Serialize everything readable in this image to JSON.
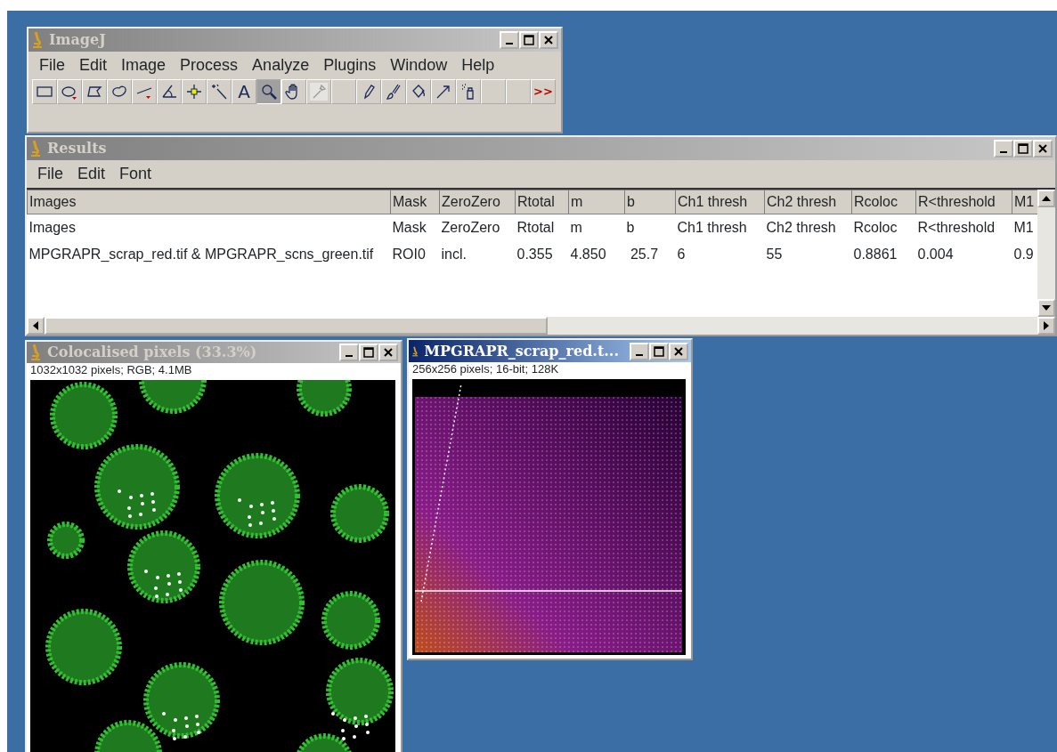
{
  "imagej_window": {
    "title": "ImageJ",
    "active": false,
    "menu": [
      "File",
      "Edit",
      "Image",
      "Process",
      "Analyze",
      "Plugins",
      "Window",
      "Help"
    ],
    "tools": [
      {
        "selected": false,
        "disabled": false
      },
      {
        "selected": false,
        "disabled": false
      },
      {
        "selected": false,
        "disabled": false
      },
      {
        "selected": false,
        "disabled": false
      },
      {
        "selected": false,
        "disabled": false
      },
      {
        "selected": false,
        "disabled": false
      },
      {
        "selected": false,
        "disabled": false
      },
      {
        "selected": false,
        "disabled": false
      },
      {
        "selected": false,
        "disabled": false,
        "text": "A"
      },
      {
        "selected": true,
        "disabled": false
      },
      {
        "selected": false,
        "disabled": false
      },
      {
        "selected": false,
        "disabled": true
      },
      {
        "selected": false,
        "disabled": false
      },
      {
        "selected": false,
        "disabled": false
      },
      {
        "selected": false,
        "disabled": false
      },
      {
        "selected": false,
        "disabled": false
      },
      {
        "selected": false,
        "disabled": false
      },
      {
        "selected": false,
        "disabled": false
      },
      {
        "selected": false,
        "disabled": false
      },
      {
        "selected": false,
        "disabled": false
      },
      {
        "selected": false,
        "disabled": false,
        "text": ">>"
      }
    ]
  },
  "results_window": {
    "title": "Results",
    "active": false,
    "menu": [
      "File",
      "Edit",
      "Font"
    ],
    "columns": [
      "Images",
      "Mask",
      "ZeroZero",
      "Rtotal",
      "m",
      "b",
      "Ch1 thresh",
      "Ch2 thresh",
      "Rcoloc",
      "R<threshold",
      "M1"
    ],
    "rows": [
      [
        "Images",
        "Mask",
        "ZeroZero",
        "Rtotal",
        "m",
        "b",
        "Ch1 thresh",
        "Ch2 thresh",
        "Rcoloc",
        "R<threshold",
        "M1"
      ],
      [
        "MPGRAPR_scrap_red.tif & MPGRAPR_scns_green.tif",
        "ROI0",
        "incl.",
        "0.355",
        "4.850",
        " 25.7",
        "6",
        "55",
        "0.8861",
        "0.004",
        "0.9"
      ]
    ]
  },
  "image_windows": [
    {
      "title": "Colocalised pixels (33.3%)",
      "active": false,
      "info": "1032x1032 pixels; RGB; 4.1MB",
      "kind": "micrograph"
    },
    {
      "title": "MPGRAPR_scrap_red.t...",
      "active": true,
      "info": "256x256 pixels; 16-bit; 128K",
      "kind": "scatter"
    }
  ]
}
